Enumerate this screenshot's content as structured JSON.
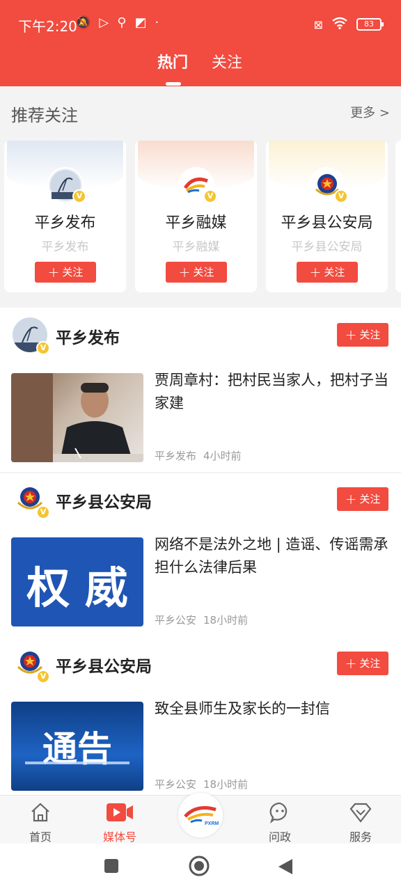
{
  "status_bar": {
    "time": "下午2:20",
    "battery": "83"
  },
  "tabs": [
    {
      "label": "热门"
    },
    {
      "label": "关注"
    }
  ],
  "recommend": {
    "title": "推荐关注",
    "more": "更多 >",
    "cards": [
      {
        "name": "平乡发布",
        "sub": "平乡发布",
        "follow": "关注"
      },
      {
        "name": "平乡融媒",
        "sub": "平乡融媒",
        "follow": "关注"
      },
      {
        "name": "平乡县公安局",
        "sub": "平乡县公安局",
        "follow": "关注"
      }
    ]
  },
  "feed": [
    {
      "author": "平乡发布",
      "follow": "关注",
      "title": "贾周章村：把村民当家人，把村子当家建",
      "source": "平乡发布",
      "time": "4小时前",
      "thumb_text": ""
    },
    {
      "author": "平乡县公安局",
      "follow": "关注",
      "title": "网络不是法外之地 | 造谣、传谣需承担什么法律后果",
      "source": "平乡公安",
      "time": "18小时前",
      "thumb_text": "权 威"
    },
    {
      "author": "平乡县公安局",
      "follow": "关注",
      "title": "致全县师生及家长的一封信",
      "source": "平乡公安",
      "time": "18小时前",
      "thumb_text": "通告"
    }
  ],
  "bottom_nav": [
    {
      "label": "首页",
      "icon": "home-icon"
    },
    {
      "label": "媒体号",
      "icon": "video-icon",
      "active": true
    },
    {
      "label": "",
      "icon": "pxrm-logo"
    },
    {
      "label": "问政",
      "icon": "chat-icon"
    },
    {
      "label": "服务",
      "icon": "service-icon"
    }
  ],
  "logo_text": "PXRM",
  "colors": {
    "accent": "#f24b3f",
    "badge": "#f5c431"
  }
}
